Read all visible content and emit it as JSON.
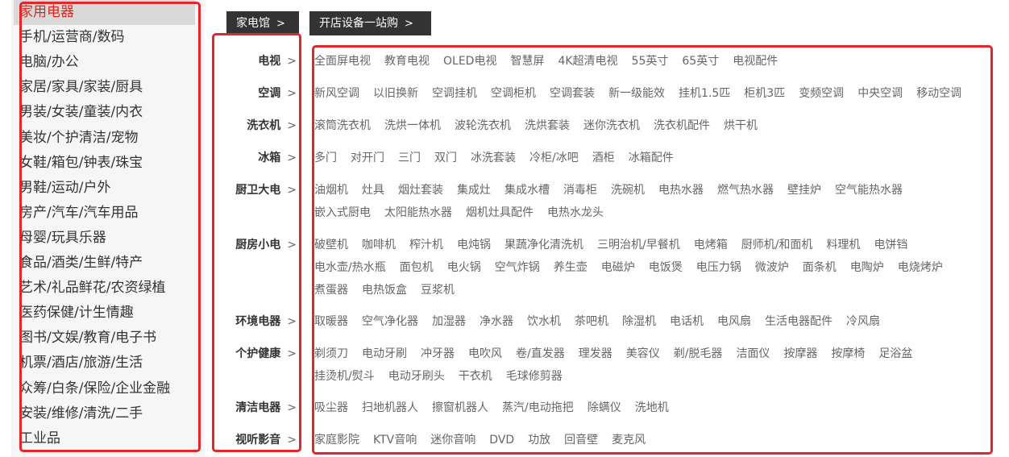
{
  "sidebar": {
    "items": [
      "家用电器",
      "手机/运营商/数码",
      "电脑/办公",
      "家居/家具/家装/厨具",
      "男装/女装/童装/内衣",
      "美妆/个护清洁/宠物",
      "女鞋/箱包/钟表/珠宝",
      "男鞋/运动/户外",
      "房产/汽车/汽车用品",
      "母婴/玩具乐器",
      "食品/酒类/生鲜/特产",
      "艺术/礼品鲜花/农资绿植",
      "医药保健/计生情趣",
      "图书/文娱/教育/电子书",
      "机票/酒店/旅游/生活",
      "众筹/白条/保险/企业金融",
      "安装/维修/清洗/二手",
      "工业品"
    ],
    "active_index": 0
  },
  "tabs": [
    "家电馆",
    "开店设备一站购"
  ],
  "chevron": ">",
  "categories": [
    {
      "name": "电视",
      "rows": [
        [
          "全面屏电视",
          "教育电视",
          "OLED电视",
          "智慧屏",
          "4K超清电视",
          "55英寸",
          "65英寸",
          "电视配件"
        ]
      ]
    },
    {
      "name": "空调",
      "rows": [
        [
          "新风空调",
          "以旧换新",
          "空调挂机",
          "空调柜机",
          "空调套装",
          "新一级能效",
          "挂机1.5匹",
          "柜机3匹",
          "变频空调",
          "中央空调",
          "移动空调"
        ]
      ]
    },
    {
      "name": "洗衣机",
      "rows": [
        [
          "滚筒洗衣机",
          "洗烘一体机",
          "波轮洗衣机",
          "洗烘套装",
          "迷你洗衣机",
          "洗衣机配件",
          "烘干机"
        ]
      ]
    },
    {
      "name": "冰箱",
      "rows": [
        [
          "多门",
          "对开门",
          "三门",
          "双门",
          "冰洗套装",
          "冷柜/冰吧",
          "酒柜",
          "冰箱配件"
        ]
      ]
    },
    {
      "name": "厨卫大电",
      "rows": [
        [
          "油烟机",
          "灶具",
          "烟灶套装",
          "集成灶",
          "集成水槽",
          "消毒柜",
          "洗碗机",
          "电热水器",
          "燃气热水器",
          "壁挂炉",
          "空气能热水器"
        ],
        [
          "嵌入式厨电",
          "太阳能热水器",
          "烟机灶具配件",
          "电热水龙头"
        ]
      ]
    },
    {
      "name": "厨房小电",
      "rows": [
        [
          "破壁机",
          "咖啡机",
          "榨汁机",
          "电炖锅",
          "果蔬净化清洗机",
          "三明治机/早餐机",
          "电烤箱",
          "厨师机/和面机",
          "料理机",
          "电饼铛"
        ],
        [
          "电水壶/热水瓶",
          "面包机",
          "电火锅",
          "空气炸锅",
          "养生壶",
          "电磁炉",
          "电饭煲",
          "电压力锅",
          "微波炉",
          "面条机",
          "电陶炉",
          "电烧烤炉"
        ],
        [
          "煮蛋器",
          "电热饭盒",
          "豆浆机"
        ]
      ]
    },
    {
      "name": "环境电器",
      "rows": [
        [
          "取暖器",
          "空气净化器",
          "加湿器",
          "净水器",
          "饮水机",
          "茶吧机",
          "除湿机",
          "电话机",
          "电风扇",
          "生活电器配件",
          "冷风扇"
        ]
      ]
    },
    {
      "name": "个护健康",
      "rows": [
        [
          "剃须刀",
          "电动牙刷",
          "冲牙器",
          "电吹风",
          "卷/直发器",
          "理发器",
          "美容仪",
          "剃/脱毛器",
          "洁面仪",
          "按摩器",
          "按摩椅",
          "足浴盆"
        ],
        [
          "挂烫机/熨斗",
          "电动牙刷头",
          "干衣机",
          "毛球修剪器"
        ]
      ]
    },
    {
      "name": "清洁电器",
      "rows": [
        [
          "吸尘器",
          "扫地机器人",
          "擦窗机器人",
          "蒸汽/电动拖把",
          "除螨仪",
          "洗地机"
        ]
      ]
    },
    {
      "name": "视听影音",
      "rows": [
        [
          "家庭影院",
          "KTV音响",
          "迷你音响",
          "DVD",
          "功放",
          "回音壁",
          "麦克风"
        ]
      ]
    }
  ],
  "colors": {
    "highlight_red": "#e4252b",
    "tab_bg": "#333333"
  }
}
